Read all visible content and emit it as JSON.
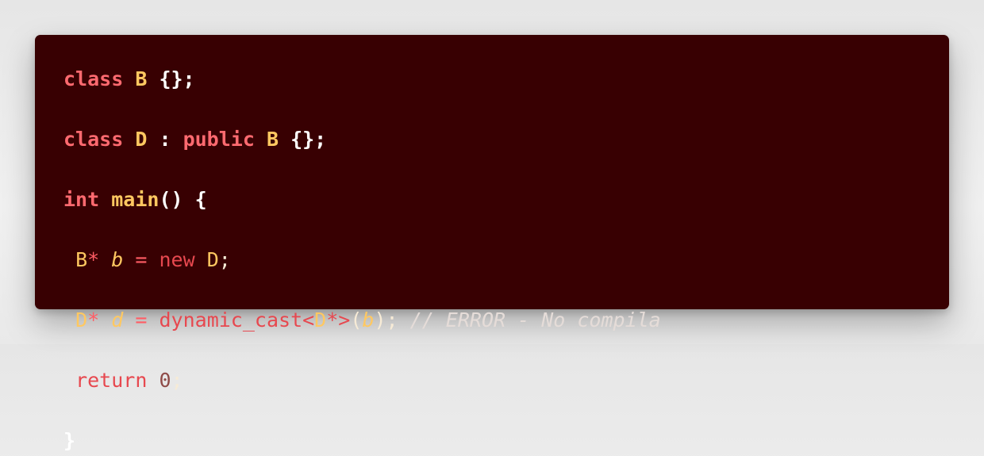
{
  "code": {
    "line1": {
      "kw_class": "class",
      "name": "B",
      "punct": "{};"
    },
    "line2": {
      "kw_class": "class",
      "name": "D",
      "colon": ":",
      "kw_public": "public",
      "base": "B",
      "punct": "{};"
    },
    "line3": {
      "kw_int": "int",
      "fn": "main",
      "punct": "() {"
    },
    "line4": {
      "type": "B",
      "star": "*",
      "var": "b",
      "eq": "=",
      "kw_new": "new",
      "new_type": "D",
      "punct": ";"
    },
    "line5": {
      "type": "D",
      "star": "*",
      "var": "d",
      "eq": "=",
      "cast": "dynamic_cast<",
      "cast_type": "D",
      "cast_end": "*>",
      "paren_open": "(",
      "arg": "b",
      "paren_close": ");",
      "comment": "// ERROR - No compila"
    },
    "line6": {
      "kw_return": "return",
      "value": "0",
      "punct": ";"
    },
    "line7": {
      "punct": "}"
    }
  }
}
